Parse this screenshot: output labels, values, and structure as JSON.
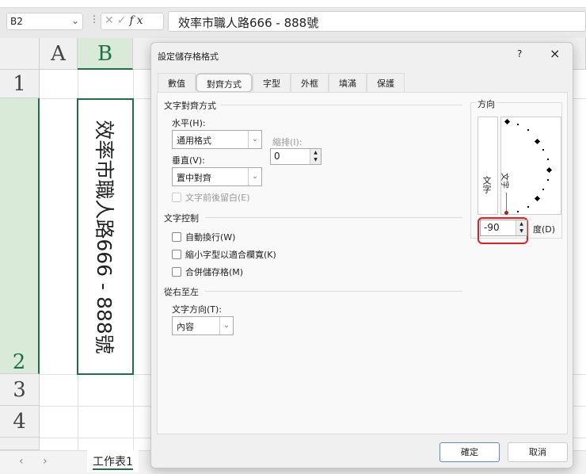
{
  "formula_bar": {
    "name_box": "B2",
    "fx_label": "fx",
    "content": "效率市職人路666 - 888號"
  },
  "columns": [
    "A",
    "B"
  ],
  "rows": [
    "1",
    "2",
    "3",
    "4"
  ],
  "cell_b2": "效率市職人路666 - 888號",
  "sheet_tab": "工作表1",
  "dialog": {
    "title": "設定儲存格格式",
    "help": "?",
    "close": "×",
    "tabs": [
      "數值",
      "對齊方式",
      "字型",
      "外框",
      "填滿",
      "保護"
    ],
    "active_tab": "對齊方式",
    "text_alignment": {
      "heading": "文字對齊方式",
      "horizontal_label": "水平(H):",
      "horizontal_value": "通用格式",
      "vertical_label": "垂直(V):",
      "vertical_value": "置中對齊",
      "indent_label": "縮排(I):",
      "indent_value": "0",
      "justify_distributed": "文字前後留白(E)"
    },
    "text_control": {
      "heading": "文字控制",
      "wrap": "自動換行(W)",
      "shrink": "縮小字型以適合欄寬(K)",
      "merge": "合併儲存格(M)"
    },
    "rtl": {
      "heading": "從右至左",
      "direction_label": "文字方向(T):",
      "direction_value": "內容"
    },
    "orientation": {
      "heading": "方向",
      "vertical_text": "文字",
      "dial_text": "文字",
      "degrees_value": "-90",
      "degrees_label": "度(D)"
    },
    "ok": "確定",
    "cancel": "取消"
  },
  "colors": {
    "accent": "#1e7145",
    "highlight": "#e02020"
  }
}
